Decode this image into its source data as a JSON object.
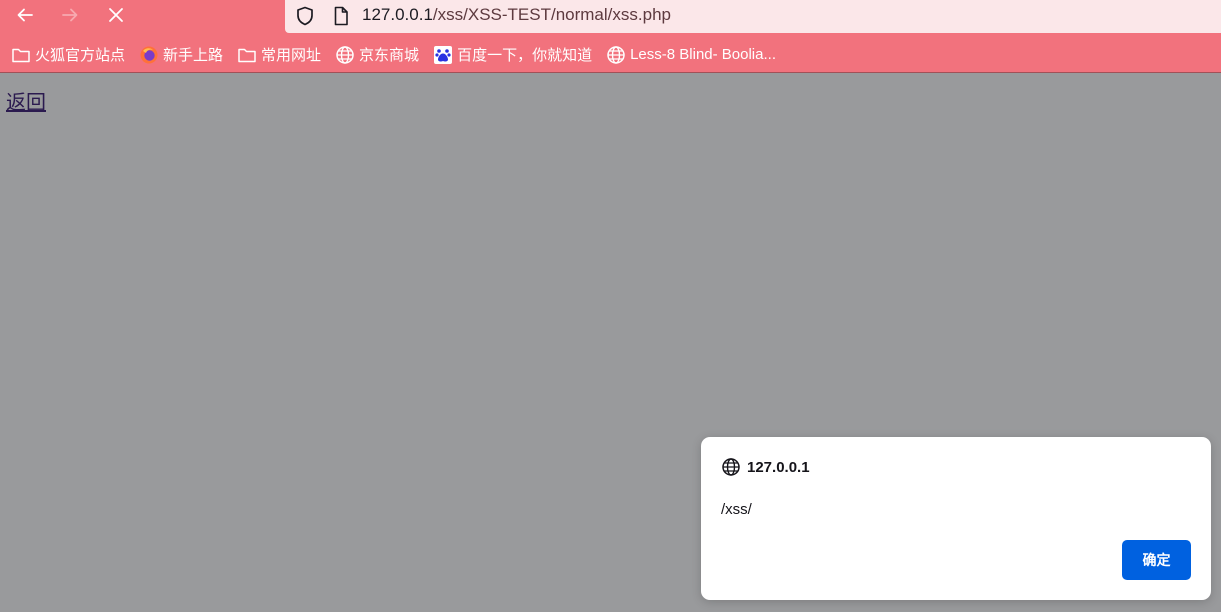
{
  "colors": {
    "toolbar_bg": "#f2727d",
    "url_bg": "#fbe7e9",
    "page_bg": "#999a9c",
    "accent": "#0061e0"
  },
  "nav": {
    "back_icon": "arrow-left-icon",
    "forward_icon": "arrow-right-icon",
    "stop_icon": "close-icon"
  },
  "urlbar": {
    "host": "127.0.0.1",
    "path": "/xss/XSS-TEST/normal/xss.php"
  },
  "bookmarks": [
    {
      "label": "火狐官方站点",
      "icon": "folder-icon"
    },
    {
      "label": "新手上路",
      "icon": "firefox-icon"
    },
    {
      "label": "常用网址",
      "icon": "folder-icon"
    },
    {
      "label": "京东商城",
      "icon": "globe-icon"
    },
    {
      "label": "百度一下，你就知道",
      "icon": "baidu-icon"
    },
    {
      "label": "Less-8 Blind- Boolia...",
      "icon": "globe-icon"
    }
  ],
  "page": {
    "back_link": "返回"
  },
  "dialog": {
    "title": "127.0.0.1",
    "message": "/xss/",
    "ok_label": "确定"
  }
}
